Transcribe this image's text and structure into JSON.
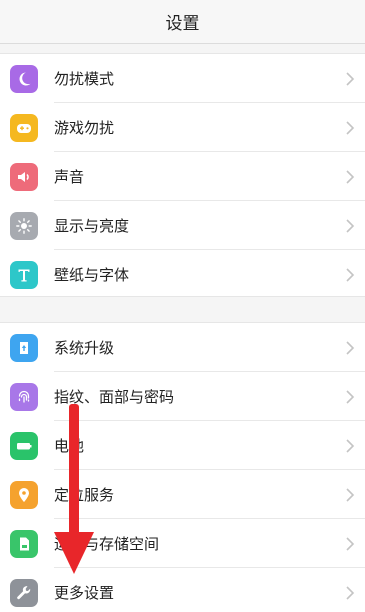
{
  "header": {
    "title": "设置"
  },
  "group1": [
    {
      "label": "勿扰模式",
      "icon": "moon-icon",
      "color": "#a86ae6"
    },
    {
      "label": "游戏勿扰",
      "icon": "gamepad-icon",
      "color": "#f5b820"
    },
    {
      "label": "声音",
      "icon": "speaker-icon",
      "color": "#ee6b7a"
    },
    {
      "label": "显示与亮度",
      "icon": "brightness-icon",
      "color": "#a7aab0"
    },
    {
      "label": "壁纸与字体",
      "icon": "font-icon",
      "color": "#2dc7c9"
    }
  ],
  "group2": [
    {
      "label": "系统升级",
      "icon": "system-update-icon",
      "color": "#3ea5f0"
    },
    {
      "label": "指纹、面部与密码",
      "icon": "fingerprint-icon",
      "color": "#a877e8"
    },
    {
      "label": "电池",
      "icon": "battery-icon",
      "color": "#2ac36a"
    },
    {
      "label": "定位服务",
      "icon": "location-icon",
      "color": "#f5a22e"
    },
    {
      "label": "运存与存储空间",
      "icon": "storage-icon",
      "color": "#39c56a"
    },
    {
      "label": "更多设置",
      "icon": "wrench-icon",
      "color": "#8e9299"
    }
  ],
  "annotation": {
    "arrow_color": "#e8262a"
  }
}
